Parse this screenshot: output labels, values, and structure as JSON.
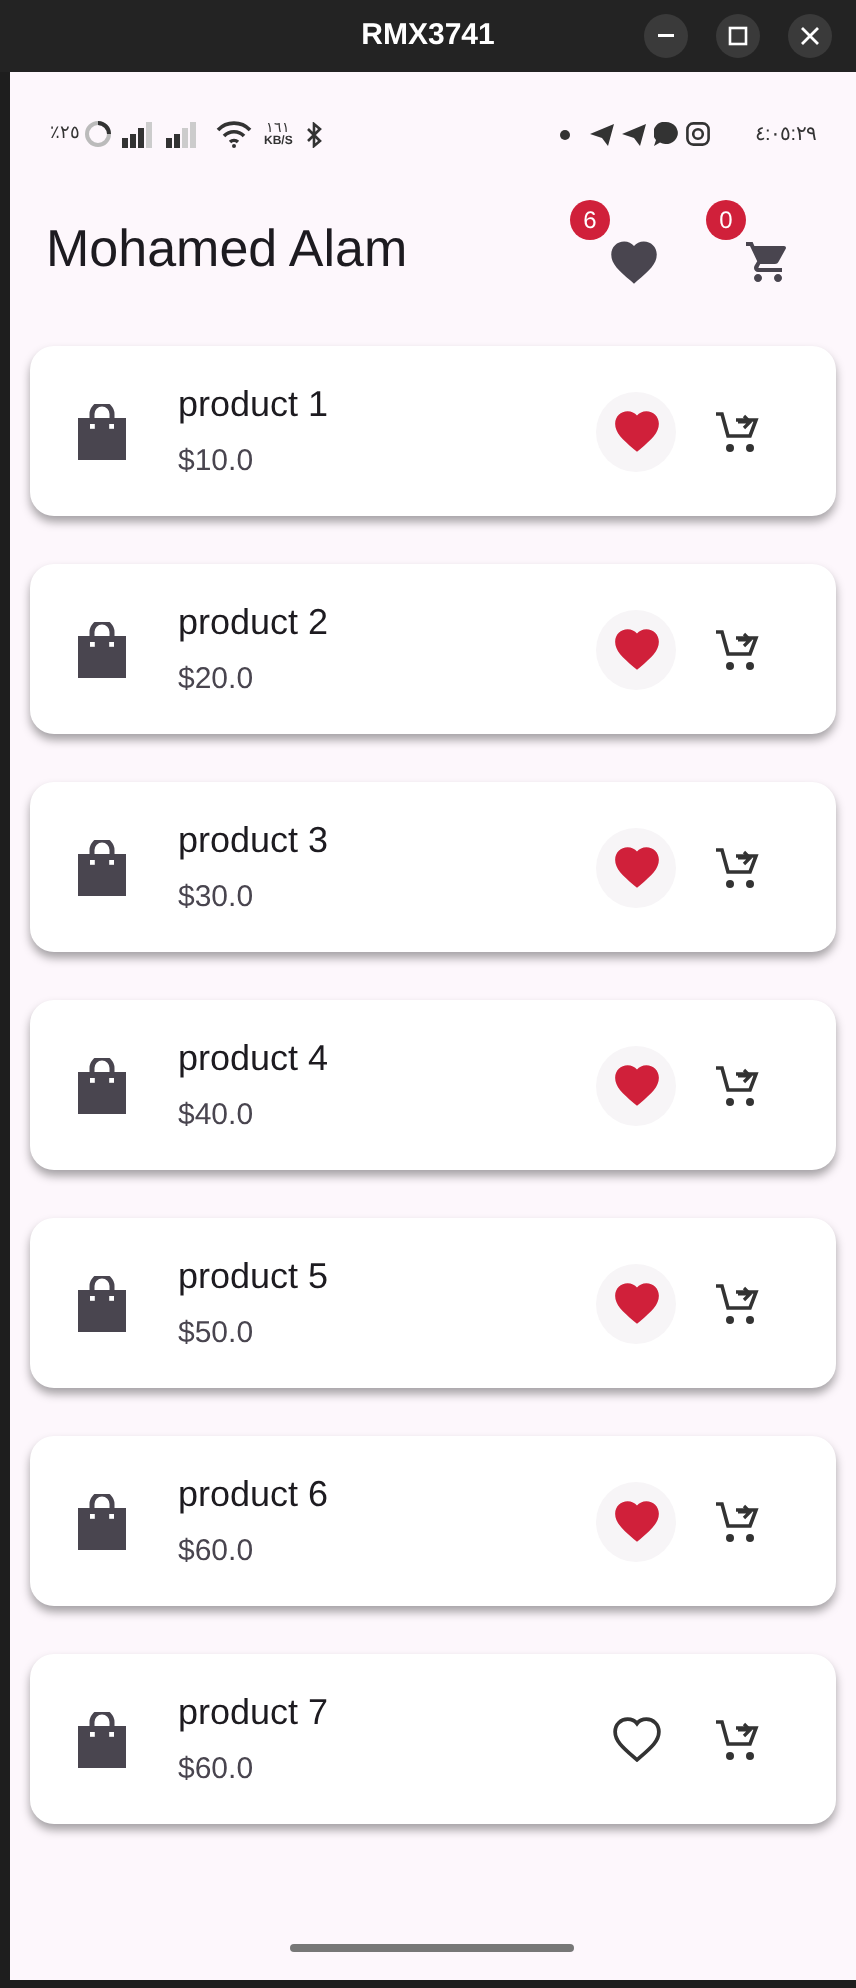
{
  "window": {
    "title": "RMX3741"
  },
  "status_bar": {
    "battery": "٪٢٥",
    "speed": "١٦١",
    "speed_unit": "KB/S",
    "time": "٤:٠٥:٢٩"
  },
  "header": {
    "title": "Mohamed Alam",
    "favorites_count": "6",
    "cart_count": "0"
  },
  "products": [
    {
      "name": "product 1",
      "price": "$10.0",
      "favorite": true
    },
    {
      "name": "product 2",
      "price": "$20.0",
      "favorite": true
    },
    {
      "name": "product 3",
      "price": "$30.0",
      "favorite": true
    },
    {
      "name": "product 4",
      "price": "$40.0",
      "favorite": true
    },
    {
      "name": "product 5",
      "price": "$50.0",
      "favorite": true
    },
    {
      "name": "product 6",
      "price": "$60.0",
      "favorite": true
    },
    {
      "name": "product 7",
      "price": "$60.0",
      "favorite": false
    }
  ]
}
